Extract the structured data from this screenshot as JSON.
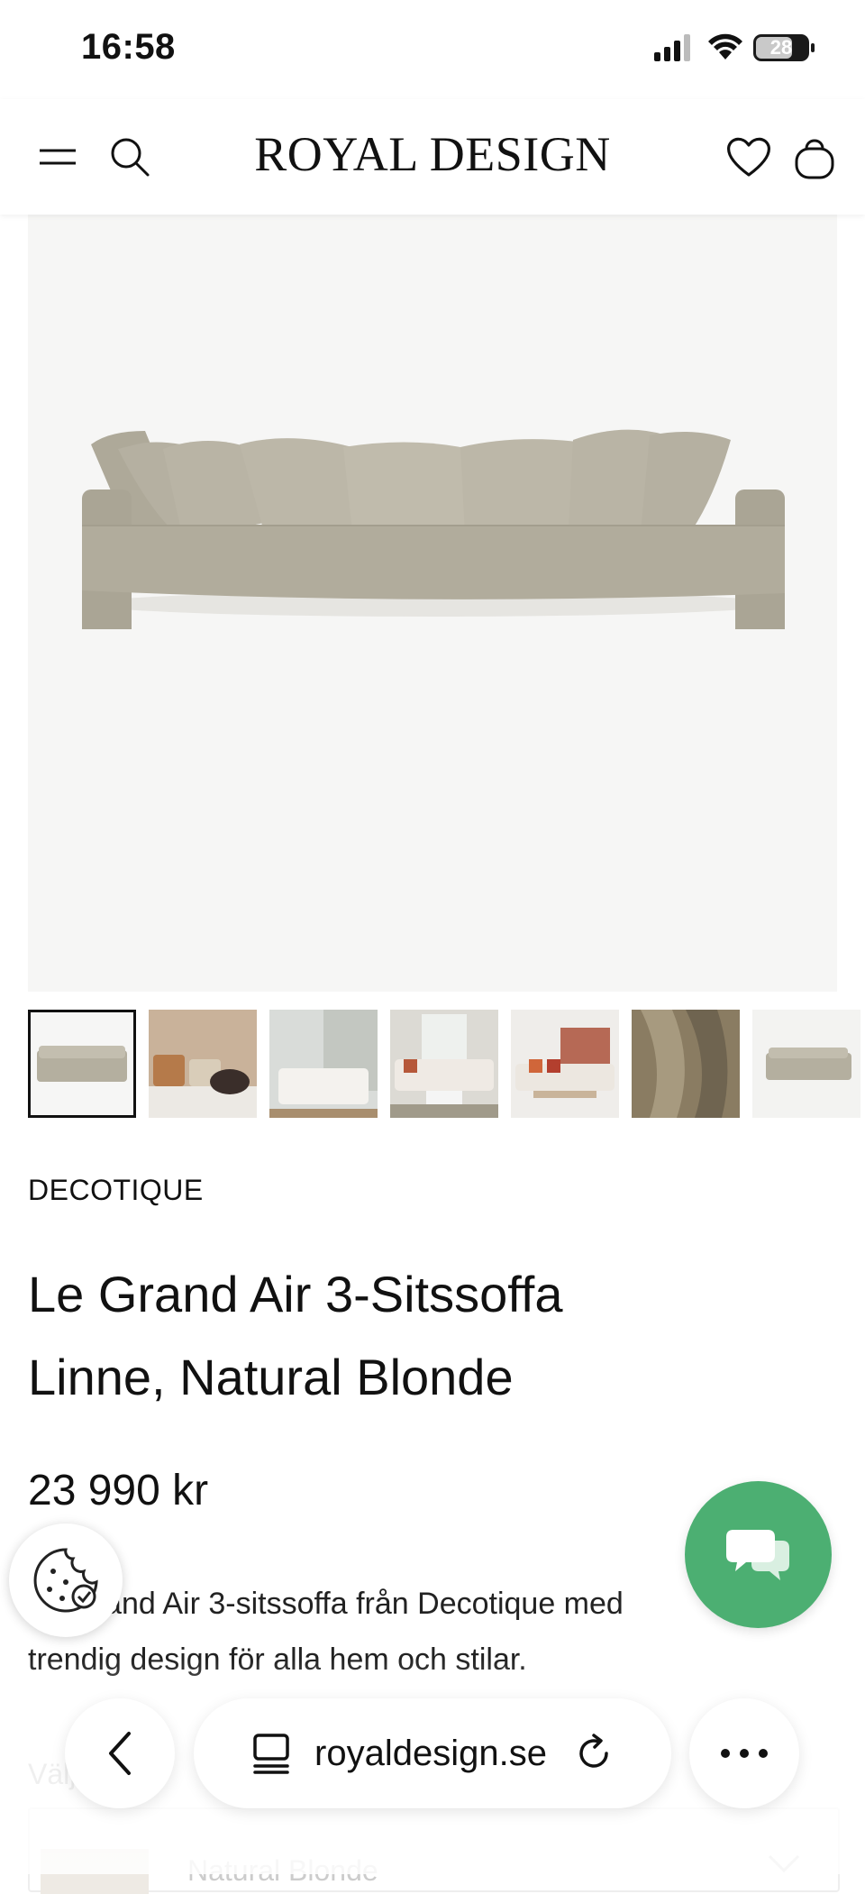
{
  "status_bar": {
    "time": "16:58",
    "battery": "28"
  },
  "header": {
    "logo": "ROYAL DESIGN"
  },
  "product": {
    "brand": "DECOTIQUE",
    "title_line1": "Le Grand Air 3-Sitssoffa",
    "title_line2": "Linne, Natural Blonde",
    "price": "23 990 kr",
    "description_line1": "Le Grand Air 3-sitssoffa från Decotique med",
    "description_line2": "trendig design för alla hem och stilar."
  },
  "variant": {
    "label": "Välj",
    "selected": "Natural Blonde"
  },
  "browser": {
    "url": "royaldesign.se"
  },
  "colors": {
    "chat": "#4caf72",
    "sofa": "#bab6a6",
    "hero_bg": "#f6f6f5"
  }
}
